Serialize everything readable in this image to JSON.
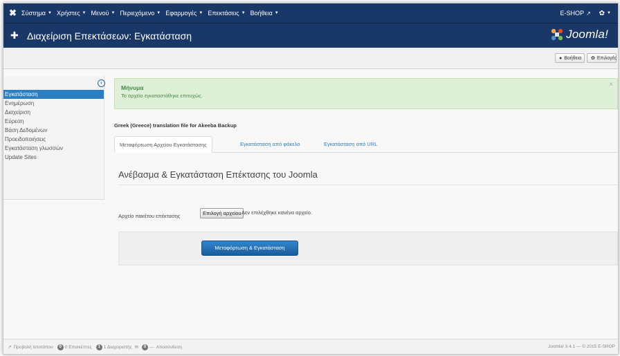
{
  "topnav": {
    "menu": [
      {
        "label": "Σύστημα"
      },
      {
        "label": "Χρήστες"
      },
      {
        "label": "Μενού"
      },
      {
        "label": "Περιεχόμενο"
      },
      {
        "label": "Εφαρμογές"
      },
      {
        "label": "Επεκτάσεις"
      },
      {
        "label": "Βοήθεια"
      }
    ],
    "site_name": "E-SHOP"
  },
  "header": {
    "title": "Διαχείριση Επεκτάσεων: Εγκατάσταση",
    "logo_text": "Joomla!"
  },
  "toolbar": {
    "help_label": "Βοήθεια",
    "options_label": "Επιλογές"
  },
  "sidebar": {
    "items": [
      {
        "label": "Εγκατάσταση",
        "active": true
      },
      {
        "label": "Ενημέρωση"
      },
      {
        "label": "Διαχείριση"
      },
      {
        "label": "Εύρεση"
      },
      {
        "label": "Βάση Δεδομένων"
      },
      {
        "label": "Προειδοποιήσεις"
      },
      {
        "label": "Εγκατάσταση γλωσσών"
      },
      {
        "label": "Update Sites"
      }
    ]
  },
  "alert": {
    "heading": "Μήνυμα",
    "text": "Το αρχείο εγκαταστάθηκε επιτυχώς.",
    "close": "×"
  },
  "content": {
    "extension_title": "Greek (Greece) translation file for Akeeba Backup",
    "tabs": [
      {
        "label": "Μεταφόρτωση Αρχείου Εγκατάστασης"
      },
      {
        "label": "Εγκατάσταση από φάκελο"
      },
      {
        "label": "Εγκατάσταση από URL"
      }
    ],
    "pane_title": "Ανέβασμα & Εγκατάσταση Επέκτασης του Joomla",
    "file_label": "Αρχείο πακέτου επέκτασης",
    "file_button": "Επιλογή αρχείου",
    "file_none": "Δεν επιλέχθηκε κανένα αρχείο.",
    "upload_button": "Μεταφόρτωση & Εγκατάσταση"
  },
  "statusbar": {
    "view_site": "Προβολή Ιστοτόπου",
    "visitors_count": "0",
    "visitors_label": "0 Επισκέπτες",
    "admins_count": "1",
    "admins_label": "1 Διαχειριστής",
    "messages_count": "0",
    "logout": "Αποσύνδεση",
    "version": "Joomla! 3.4.1 — © 2015 E-SHOP"
  },
  "colors": {
    "nav_bg": "#1a3867",
    "accent": "#2a7ec2",
    "alert_bg": "#dff0d8",
    "alert_text": "#468847"
  }
}
